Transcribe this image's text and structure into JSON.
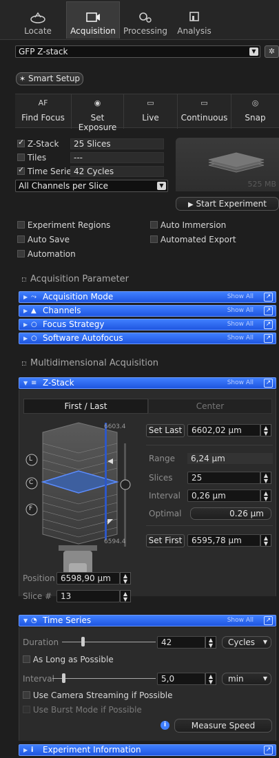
{
  "tabs": [
    {
      "label": "Locate",
      "icon": "locate-icon"
    },
    {
      "label": "Acquisition",
      "icon": "acquisition-icon",
      "active": true
    },
    {
      "label": "Processing",
      "icon": "processing-icon"
    },
    {
      "label": "Analysis",
      "icon": "analysis-icon"
    }
  ],
  "experiment": {
    "selected": "GFP Z-stack",
    "gear_icon": "gear-icon"
  },
  "smart_setup": {
    "label": "Smart Setup"
  },
  "tools": [
    {
      "glyph": "AF",
      "label": "Find Focus"
    },
    {
      "glyph": "camera-icon",
      "label": "Set Exposure"
    },
    {
      "glyph": "live-icon",
      "label": "Live"
    },
    {
      "glyph": "continuous-icon",
      "label": "Continuous"
    },
    {
      "glyph": "snap-icon",
      "label": "Snap"
    }
  ],
  "dimensions": [
    {
      "label": "Z-Stack",
      "checked": true,
      "value": "25 Slices"
    },
    {
      "label": "Tiles",
      "checked": false,
      "value": "---"
    },
    {
      "label": "Time Series",
      "checked": true,
      "value": "42 Cycles"
    }
  ],
  "channel_mode": "All Channels per Slice",
  "preview_size": "525 MB",
  "start_experiment": "Start Experiment",
  "options": {
    "left": [
      {
        "label": "Experiment Regions",
        "checked": false
      },
      {
        "label": "Auto Save",
        "checked": false
      },
      {
        "label": "Automation",
        "checked": false
      }
    ],
    "right": [
      {
        "label": "Auto Immersion",
        "checked": false
      },
      {
        "label": "Automated Export",
        "checked": false
      }
    ]
  },
  "acq_param_title": "Acquisition Parameter",
  "acq_bars": [
    {
      "label": "Acquisition Mode",
      "icon": "acquisition-mode-icon"
    },
    {
      "label": "Channels",
      "icon": "channels-icon"
    },
    {
      "label": "Focus Strategy",
      "icon": "focus-strategy-icon"
    },
    {
      "label": "Software Autofocus",
      "icon": "autofocus-icon"
    }
  ],
  "show_all": "Show All",
  "multi_title": "Multidimensional Acquisition",
  "zstack": {
    "title": "Z-Stack",
    "tab_first_last": "First / Last",
    "tab_center": "Center",
    "top_value": "6603.4",
    "bottom_value": "6594.4",
    "set_last": "Set Last",
    "last_value": "6602,02 µm",
    "range_label": "Range",
    "range_value": "6,24 µm",
    "slices_label": "Slices",
    "slices_value": "25",
    "interval_label": "Interval",
    "interval_value": "0,26 µm",
    "optimal_label": "Optimal",
    "optimal_value": "0.26 µm",
    "set_first": "Set First",
    "first_value": "6595,78 µm",
    "position_label": "Position",
    "position_value": "6598,90 µm",
    "slice_label": "Slice #",
    "slice_value": "13",
    "markers": [
      "L",
      "C",
      "F"
    ]
  },
  "time_series": {
    "title": "Time Series",
    "duration_label": "Duration",
    "duration_value": "42",
    "duration_unit": "Cycles",
    "as_long_as_possible": "As Long as Possible",
    "interval_label": "Interval",
    "interval_value": "5,0",
    "interval_unit": "min",
    "camera_streaming": "Use Camera Streaming if Possible",
    "burst_mode": "Use Burst Mode if Possible",
    "measure_speed": "Measure Speed"
  },
  "experiment_info": {
    "title": "Experiment Information"
  },
  "colors": {
    "accent_blue": "#2a63f0",
    "panel": "#2b2b2b",
    "background": "#1e1e1e"
  }
}
